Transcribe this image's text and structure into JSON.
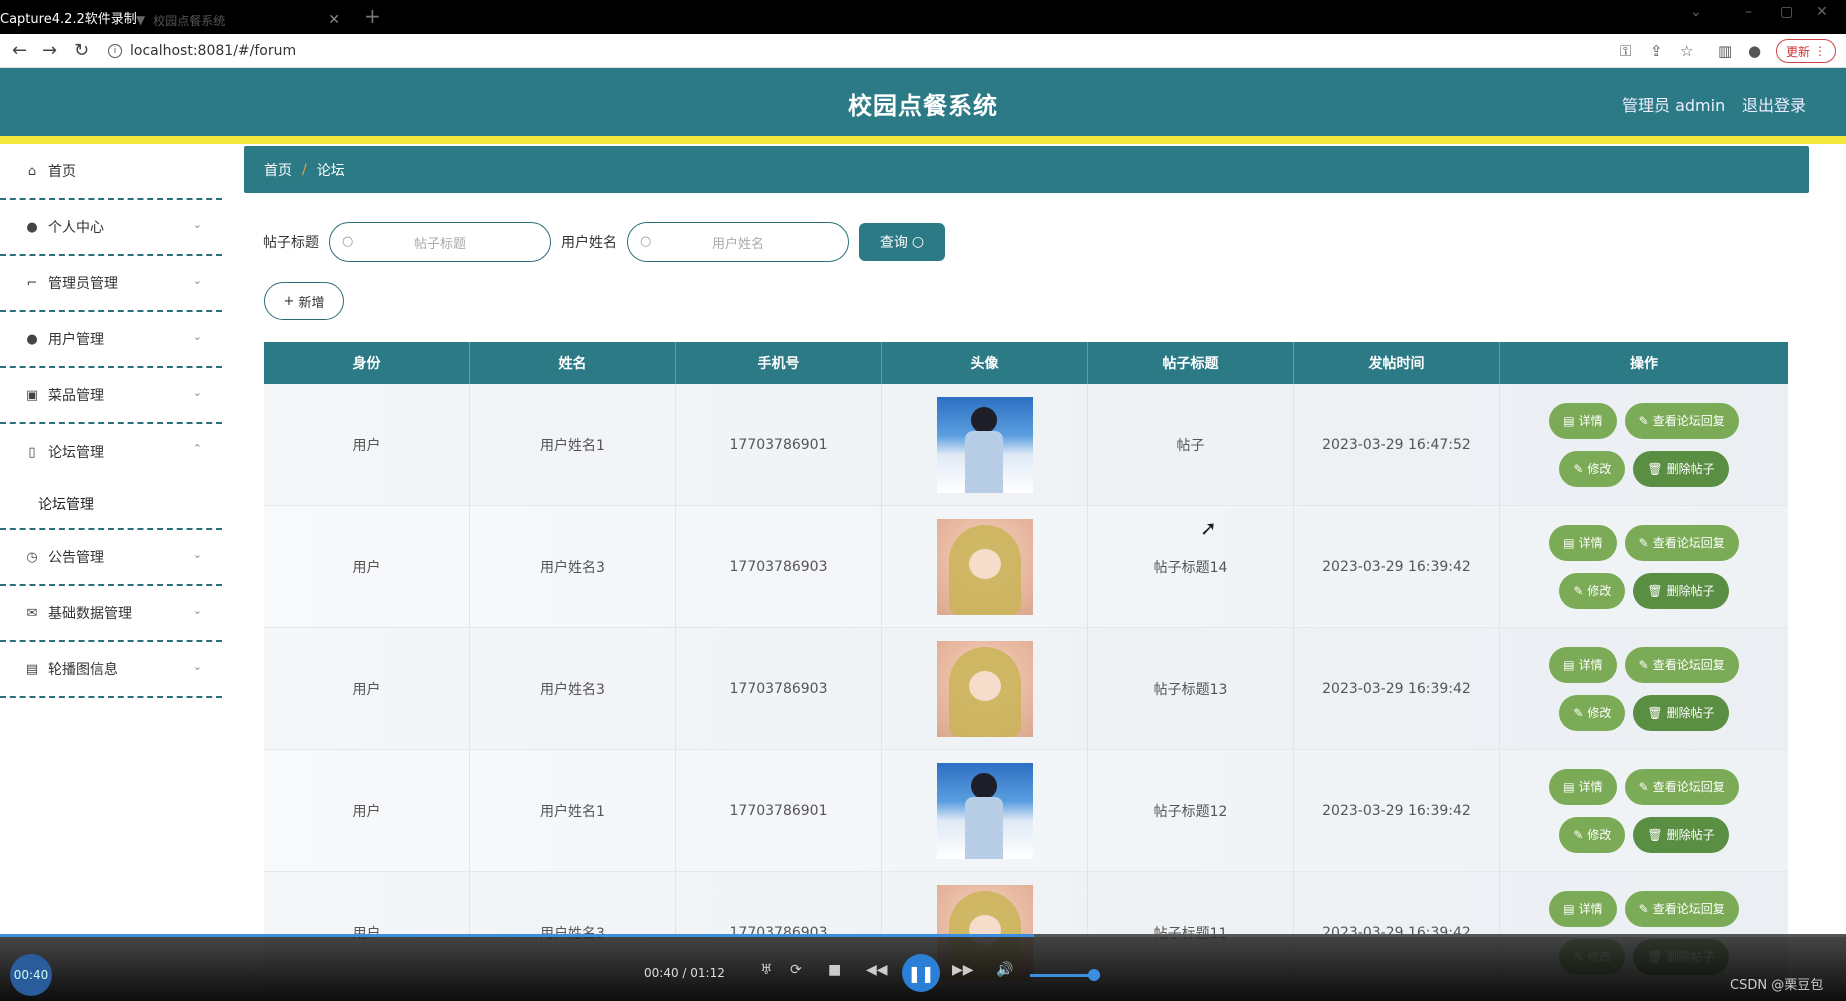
{
  "browser": {
    "window_title": "Capture4.2.2软件录制",
    "tab_title": "校园点餐系统",
    "url": "localhost:8081/#/forum",
    "update_label": "更新"
  },
  "header": {
    "title": "校园点餐系统",
    "user": "管理员 admin",
    "logout": "退出登录"
  },
  "sidebar": {
    "items": [
      {
        "label": "首页",
        "icon": "home-icon"
      },
      {
        "label": "个人中心",
        "icon": "user-icon"
      },
      {
        "label": "管理员管理",
        "icon": "crop-icon"
      },
      {
        "label": "用户管理",
        "icon": "user-icon"
      },
      {
        "label": "菜品管理",
        "icon": "clipboard-icon"
      },
      {
        "label": "论坛管理",
        "icon": "phone-icon"
      },
      {
        "label": "公告管理",
        "icon": "clock-icon"
      },
      {
        "label": "基础数据管理",
        "icon": "mail-icon"
      },
      {
        "label": "轮播图信息",
        "icon": "card-icon"
      }
    ],
    "sub_forum": "论坛管理"
  },
  "breadcrumb": {
    "home": "首页",
    "sep": "/",
    "current": "论坛"
  },
  "search": {
    "title_label": "帖子标题",
    "title_placeholder": "帖子标题",
    "name_label": "用户姓名",
    "name_placeholder": "用户姓名",
    "query_label": "查询"
  },
  "add_label": "新增",
  "table": {
    "headers": [
      "身份",
      "姓名",
      "手机号",
      "头像",
      "帖子标题",
      "发帖时间",
      "操作"
    ],
    "rows": [
      {
        "role": "用户",
        "name": "用户姓名1",
        "phone": "17703786901",
        "avatar": "boy",
        "title": "帖子",
        "time": "2023-03-29 16:47:52"
      },
      {
        "role": "用户",
        "name": "用户姓名3",
        "phone": "17703786903",
        "avatar": "girl",
        "title": "帖子标题14",
        "time": "2023-03-29 16:39:42"
      },
      {
        "role": "用户",
        "name": "用户姓名3",
        "phone": "17703786903",
        "avatar": "girl",
        "title": "帖子标题13",
        "time": "2023-03-29 16:39:42"
      },
      {
        "role": "用户",
        "name": "用户姓名1",
        "phone": "17703786901",
        "avatar": "boy",
        "title": "帖子标题12",
        "time": "2023-03-29 16:39:42"
      },
      {
        "role": "用户",
        "name": "用户姓名3",
        "phone": "17703786903",
        "avatar": "girl",
        "title": "帖子标题11",
        "time": "2023-03-29 16:39:42"
      }
    ],
    "actions": {
      "detail": "详情",
      "reply": "查看论坛回复",
      "edit": "修改",
      "delete": "删除帖子"
    }
  },
  "player": {
    "badge_time": "00:40",
    "time": "00:40 / 01:12",
    "progress": 0.56,
    "watermark": "CSDN @栗豆包"
  },
  "colors": {
    "primary": "#2b7a86",
    "accent_line": "#f4e83c",
    "op_button": "#7bab56"
  }
}
